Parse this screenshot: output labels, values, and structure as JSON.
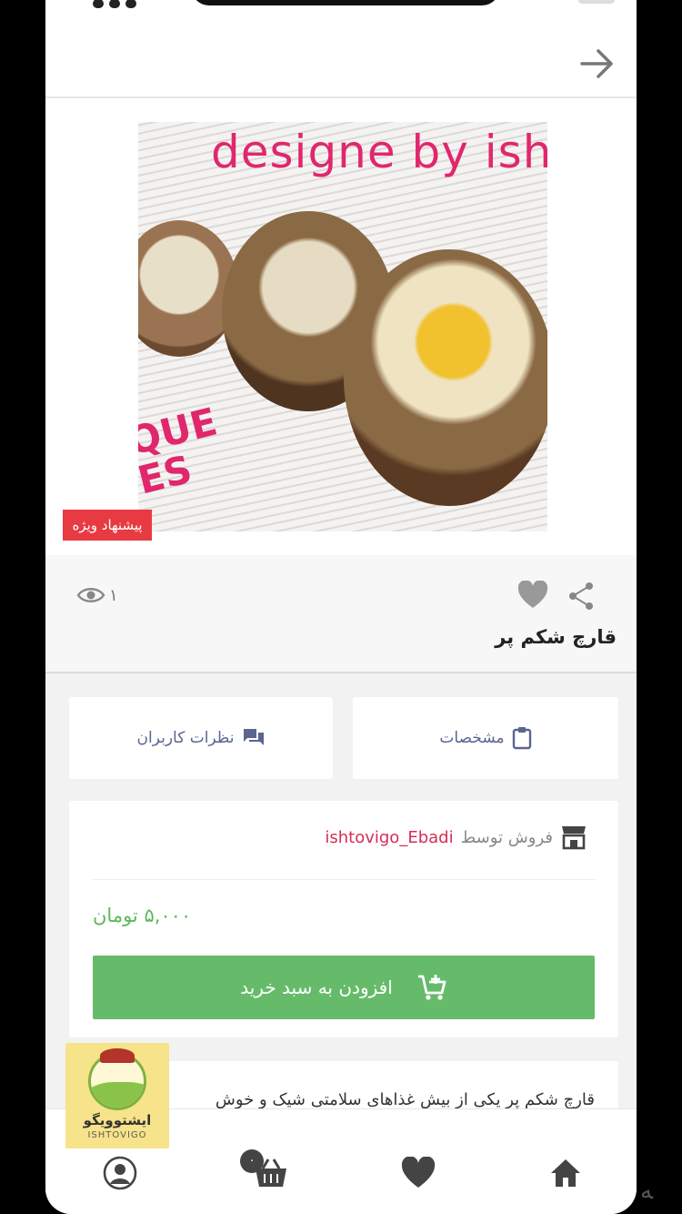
{
  "header": {
    "back_icon": "arrow-right-icon"
  },
  "product": {
    "image_watermark": "designe by ishtov",
    "image_edge_text": "QUE\nES",
    "special_offer_label": "پیشنهاد ویژه",
    "views_count": "۱",
    "title": "قارچ شکم پر"
  },
  "tabs": [
    {
      "label": "مشخصات",
      "icon": "clipboard-icon"
    },
    {
      "label": "نظرات کاربران",
      "icon": "chat-icon"
    }
  ],
  "seller": {
    "sold_by_label": "فروش توسط",
    "name": "ishtovigo_Ebadi",
    "icon": "store-icon"
  },
  "price": {
    "amount": "۵,۰۰۰",
    "currency": "تومان"
  },
  "add_to_cart": {
    "label": "افزودن به سبد خرید",
    "icon": "cart-add-icon"
  },
  "description": {
    "preview": "قارچ شکم پر یکی از بیش غذاهای سلامتی شیک و خوش"
  },
  "logo": {
    "fa_text": "ایشتوویگو",
    "en_text": "ISHTOVIGO"
  },
  "bottom_nav": {
    "cart_badge": "۰",
    "items": [
      "profile-icon",
      "basket-icon",
      "heart-icon",
      "home-icon"
    ]
  },
  "colors": {
    "accent_green": "#66bb6a",
    "price_green": "#5cb85c",
    "badge_red": "#e83a42",
    "seller_red": "#d62d55",
    "tab_text": "#5a6590"
  }
}
